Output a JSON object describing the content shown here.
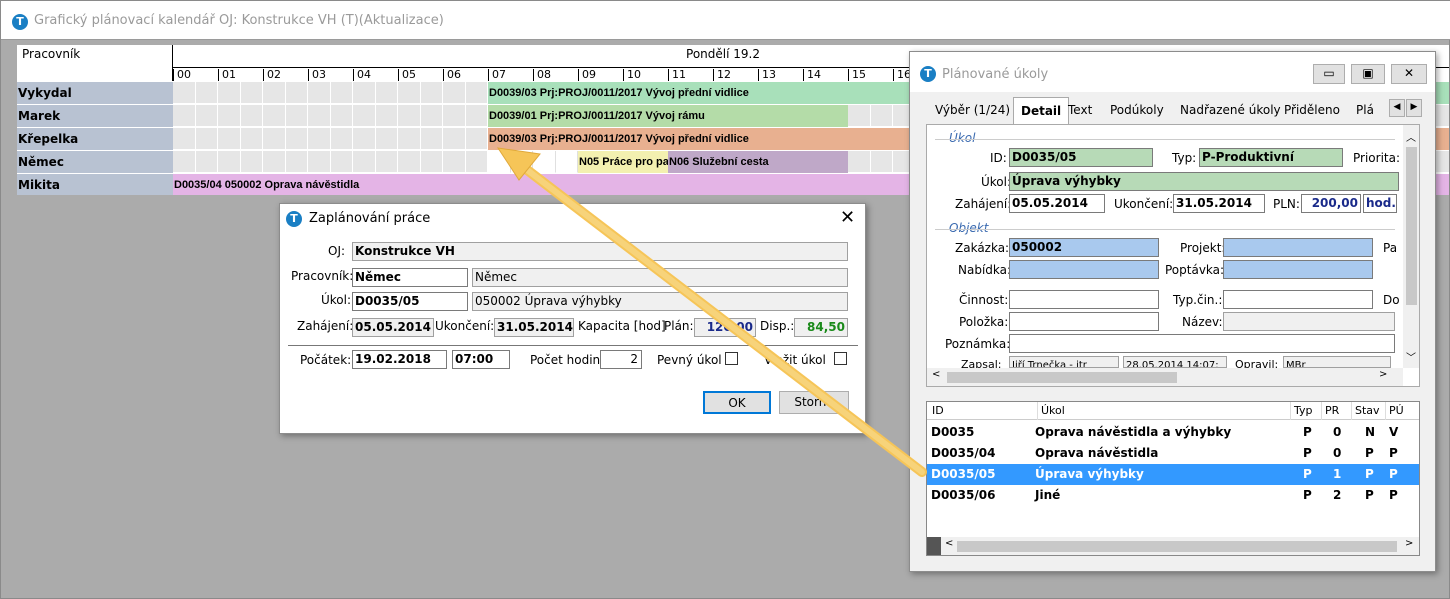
{
  "main": {
    "title": "Grafický plánovací kalendář OJ: Konstrukce VH (T)(Aktualizace)",
    "worker_header": "Pracovník",
    "day_label": "Pondělí 19.2",
    "hours": [
      "00",
      "01",
      "02",
      "03",
      "04",
      "05",
      "06",
      "07",
      "08",
      "09",
      "10",
      "11",
      "12",
      "13",
      "14",
      "15",
      "16"
    ],
    "workers": [
      "Vykydal",
      "Marek",
      "Křepelka",
      "Němec",
      "Mikita"
    ],
    "bars": [
      {
        "text": "D0039/03 Prj:PROJ/0011/2017 Vývoj přední vidlice",
        "color": "#a8e0ba"
      },
      {
        "text": "D0039/01 Prj:PROJ/0011/2017 Vývoj rámu",
        "color": "#b4dca8"
      },
      {
        "text": "D0039/03 Prj:PROJ/0011/2017 Vývoj přední vidlice",
        "color": "#e8b090"
      },
      {
        "text": "N05 Práce pro pa",
        "color": "#f3f0b0"
      },
      {
        "text": "N06 Služební cesta",
        "color": "#bfa8c8"
      },
      {
        "text": "D0035/04 050002 Oprava návěstidla",
        "color": "#e4b4e6"
      }
    ]
  },
  "dialog_plan": {
    "title": "Zaplánování práce",
    "oj_label": "OJ:",
    "oj_value": "Konstrukce VH",
    "worker_label": "Pracovník:",
    "worker_value": "Němec",
    "worker_name": "Němec",
    "task_label": "Úkol:",
    "task_value": "D0035/05",
    "task_name": "050002 Úprava výhybky",
    "start_label": "Zahájení:",
    "start_value": "05.05.2014",
    "end_label": "Ukončení:",
    "end_value": "31.05.2014",
    "capacity_label": "Kapacita [hod]",
    "plan_label": "Plán:",
    "plan_value": "120,00",
    "disp_label": "Disp.:",
    "disp_value": "84,50",
    "begin_label": "Počátek:",
    "begin_date": "19.02.2018",
    "begin_time": "07:00",
    "hours_label": "Počet hodin:",
    "hours_value": "2",
    "fixed_label": "Pevný úkol",
    "insert_label": "Vložit úkol",
    "ok_label": "OK",
    "cancel_label": "Storno"
  },
  "dialog_tasks": {
    "title": "Plánované úkoly",
    "tabs": [
      "Výběr (1/24)",
      "Detail",
      "Text",
      "Podúkoly",
      "Nadřazené úkoly",
      "Přiděleno",
      "Plá"
    ],
    "task_section": "Úkol",
    "id_label": "ID:",
    "id_value": "D0035/05",
    "type_label": "Typ:",
    "type_value": "P-Produktivní",
    "priority_label": "Priorita:",
    "task_label": "Úkol:",
    "task_value": "Úprava výhybky",
    "start_label": "Zahájení:",
    "start_value": "05.05.2014",
    "end_label": "Ukončení:",
    "end_value": "31.05.2014",
    "pln_label": "PLN:",
    "pln_value": "200,00",
    "unit_value": "hod.",
    "object_section": "Objekt",
    "order_label": "Zakázka:",
    "order_value": "050002",
    "project_label": "Projekt:",
    "pa_label": "Pa",
    "offer_label": "Nabídka:",
    "demand_label": "Poptávka:",
    "activity_label": "Činnost:",
    "activity_type_label": "Typ.čin.:",
    "do_label": "Do",
    "item_label": "Položka:",
    "name_label": "Název:",
    "note_label": "Poznámka:",
    "recorded_label": "Zapsal:",
    "recorded_value": "Jiří Trnečka - itr",
    "recorded_date": "28.05.2014 14:07:",
    "edited_label": "Opravil:",
    "edited_value": "MBr",
    "table": {
      "headers": [
        "ID",
        "Úkol",
        "Typ",
        "PR",
        "Stav",
        "PÚ"
      ],
      "rows": [
        [
          "D0035",
          "Oprava návěstidla a výhybky",
          "P",
          "0",
          "N",
          "V"
        ],
        [
          "D0035/04",
          "Oprava návěstidla",
          "P",
          "0",
          "P",
          "P"
        ],
        [
          "D0035/05",
          "Úprava výhybky",
          "P",
          "1",
          "P",
          "P"
        ],
        [
          "D0035/06",
          "Jiné",
          "P",
          "2",
          "P",
          "P"
        ]
      ]
    }
  }
}
